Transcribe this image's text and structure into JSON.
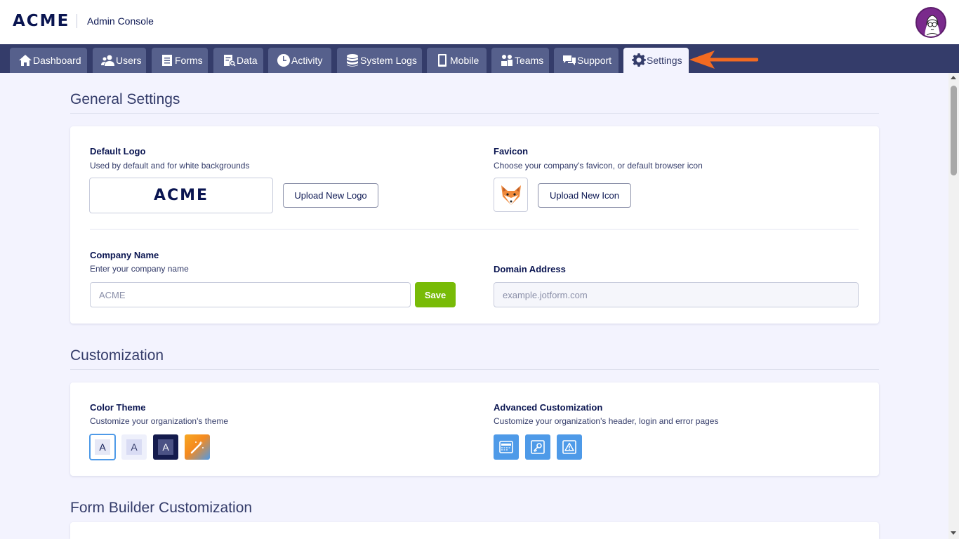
{
  "header": {
    "logo": "ACME",
    "subtitle": "Admin Console"
  },
  "nav": {
    "tabs": [
      {
        "label": "Dashboard",
        "icon": "home-icon"
      },
      {
        "label": "Users",
        "icon": "users-icon"
      },
      {
        "label": "Forms",
        "icon": "forms-icon"
      },
      {
        "label": "Data",
        "icon": "data-icon"
      },
      {
        "label": "Activity",
        "icon": "clock-icon"
      },
      {
        "label": "System Logs",
        "icon": "database-icon"
      },
      {
        "label": "Mobile",
        "icon": "mobile-icon"
      },
      {
        "label": "Teams",
        "icon": "teams-icon"
      },
      {
        "label": "Support",
        "icon": "support-icon"
      },
      {
        "label": "Settings",
        "icon": "gear-icon",
        "active": true
      }
    ]
  },
  "general": {
    "title": "General Settings",
    "default_logo": {
      "label": "Default Logo",
      "desc": "Used by default and for white backgrounds",
      "preview": "ACME",
      "button": "Upload New Logo"
    },
    "favicon": {
      "label": "Favicon",
      "desc": "Choose your company's favicon, or default browser icon",
      "button": "Upload New Icon"
    },
    "company": {
      "label": "Company Name",
      "desc": "Enter your company name",
      "value": "ACME",
      "save": "Save"
    },
    "domain": {
      "label": "Domain Address",
      "placeholder": "example.jotform.com"
    }
  },
  "customization": {
    "title": "Customization",
    "color_theme": {
      "label": "Color Theme",
      "desc": "Customize your organization's theme",
      "swatches": [
        "A",
        "A",
        "A"
      ]
    },
    "advanced": {
      "label": "Advanced Customization",
      "desc": "Customize your organization's header, login and error pages"
    }
  },
  "form_builder": {
    "title": "Form Builder Customization"
  },
  "colors": {
    "nav_bg": "#343c6a",
    "tab_bg": "#56608c",
    "accent_green": "#78bb07",
    "arrow": "#f26a21",
    "icon_blue": "#4e9ae8"
  }
}
